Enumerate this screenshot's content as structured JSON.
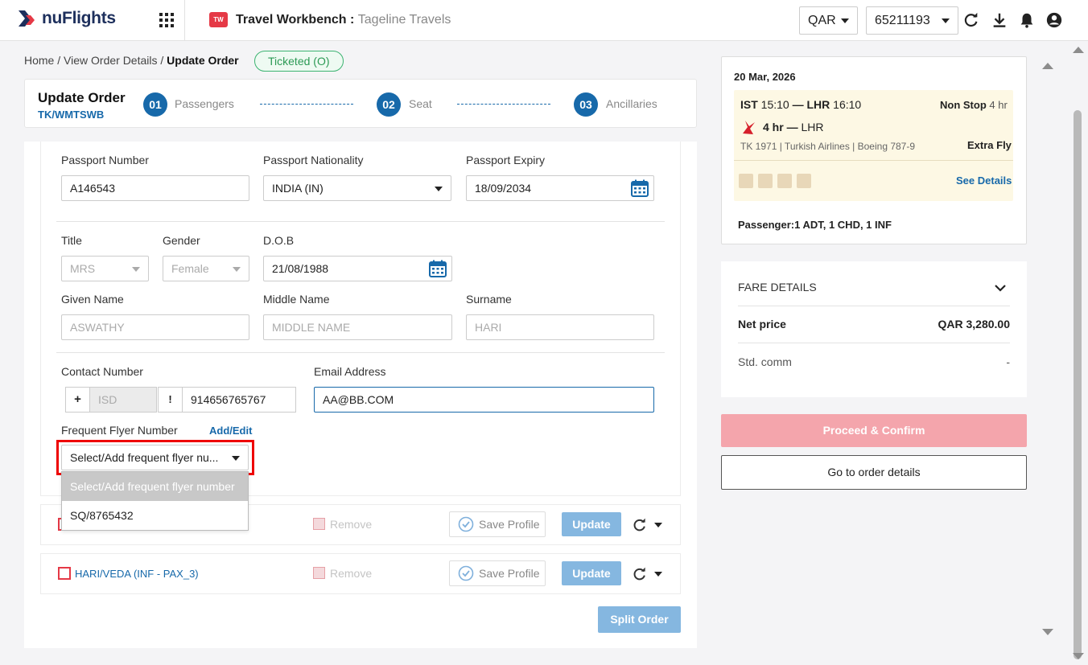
{
  "header": {
    "logo_text": "nuFlights",
    "app_icon_text": "TW",
    "title": "Travel Workbench :",
    "agency": "Tageline Travels",
    "currency": "QAR",
    "account": "65211193"
  },
  "breadcrumb": {
    "home": "Home",
    "sep": "/",
    "view": "View Order Details",
    "current": "Update Order"
  },
  "status_badge": "Ticketed (O)",
  "order": {
    "title": "Update Order",
    "pnr": "TK/WMTSWB",
    "steps": [
      {
        "num": "01",
        "label": "Passengers"
      },
      {
        "num": "02",
        "label": "Seat"
      },
      {
        "num": "03",
        "label": "Ancillaries"
      }
    ]
  },
  "form": {
    "passport_number_label": "Passport Number",
    "passport_number": "A146543",
    "nationality_label": "Passport Nationality",
    "nationality": "INDIA (IN)",
    "expiry_label": "Passport Expiry",
    "expiry": "18/09/2034",
    "title_label": "Title",
    "title_value": "MRS",
    "gender_label": "Gender",
    "gender_value": "Female",
    "dob_label": "D.O.B",
    "dob": "21/08/1988",
    "given_name_label": "Given Name",
    "given_name": "ASWATHY",
    "middle_name_label": "Middle Name",
    "middle_name_placeholder": "MIDDLE NAME",
    "surname_label": "Surname",
    "surname": "HARI",
    "contact_label": "Contact Number",
    "plus": "+",
    "isd_placeholder": "ISD",
    "bang": "!",
    "contact_number": "914656765767",
    "email_label": "Email Address",
    "email": "AA@BB.COM",
    "ffn_label": "Frequent Flyer Number",
    "ffn_add": "Add/Edit",
    "ffn_selected": "Select/Add frequent flyer nu...",
    "ffn_options": [
      "Select/Add frequent flyer number",
      "SQ/8765432"
    ]
  },
  "pax_rows": [
    {
      "name": "",
      "remove": "Remove",
      "save": "Save Profile",
      "update": "Update"
    },
    {
      "name": "HARI/VEDA (INF - PAX_3)",
      "remove": "Remove",
      "save": "Save Profile",
      "update": "Update"
    }
  ],
  "split_order": "Split Order",
  "flight": {
    "date": "20 Mar, 2026",
    "from": "IST",
    "dep": "15:10",
    "dash": "—",
    "to": "LHR",
    "arr": "16:10",
    "stops": "Non Stop",
    "duration": "4 hr",
    "leg_duration": "4 hr",
    "leg_to": "LHR",
    "details": "TK 1971 | Turkish Airlines | Boeing 787-9",
    "fare_brand": "Extra Fly",
    "see_details": "See Details",
    "passengers": "Passenger:1 ADT, 1 CHD, 1 INF"
  },
  "fare": {
    "title": "FARE DETAILS",
    "net_label": "Net price",
    "net_value": "QAR 3,280.00",
    "comm_label": "Std. comm",
    "comm_value": "-"
  },
  "actions": {
    "proceed": "Proceed & Confirm",
    "goto": "Go to order details"
  },
  "colors": {
    "primary": "#1769aa",
    "brand_red": "#e53946",
    "ticketed_green": "#2c9a55"
  }
}
